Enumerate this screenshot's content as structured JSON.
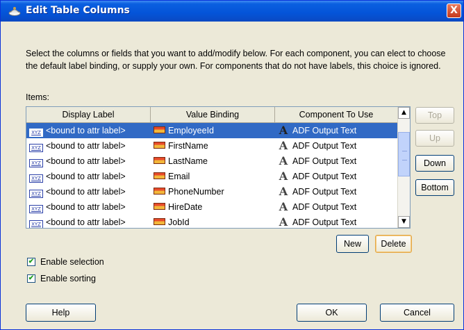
{
  "window": {
    "title": "Edit Table Columns",
    "close_label": "X"
  },
  "description": "Select the columns or fields that you want to add/modify below. For each component, you can elect to choose the default label binding, or supply your own. For components that do not have labels, this choice is ignored.",
  "items_label": "Items:",
  "table": {
    "headers": [
      "Display Label",
      "Value Binding",
      "Component To Use"
    ],
    "rows": [
      {
        "label": "<bound to attr label>",
        "binding": "EmployeeId",
        "component": "ADF Output Text",
        "selected": true
      },
      {
        "label": "<bound to attr label>",
        "binding": "FirstName",
        "component": "ADF Output Text"
      },
      {
        "label": "<bound to attr label>",
        "binding": "LastName",
        "component": "ADF Output Text"
      },
      {
        "label": "<bound to attr label>",
        "binding": "Email",
        "component": "ADF Output Text"
      },
      {
        "label": "<bound to attr label>",
        "binding": "PhoneNumber",
        "component": "ADF Output Text"
      },
      {
        "label": "<bound to attr label>",
        "binding": "HireDate",
        "component": "ADF Output Text"
      },
      {
        "label": "<bound to attr label>",
        "binding": "JobId",
        "component": "ADF Output Text"
      }
    ],
    "label_icon": "xyz-icon",
    "binding_icon": "attribute-binding-icon",
    "component_icon": "adf-component-icon",
    "selection_color": "#316ac5"
  },
  "side_buttons": {
    "top": "Top",
    "up": "Up",
    "down": "Down",
    "bottom": "Bottom"
  },
  "table_buttons": {
    "new": "New",
    "delete": "Delete"
  },
  "checkboxes": {
    "selection": {
      "label": "Enable selection",
      "checked": true
    },
    "sorting": {
      "label": "Enable sorting",
      "checked": true
    }
  },
  "footer": {
    "help": "Help",
    "ok": "OK",
    "cancel": "Cancel"
  },
  "accent_color": "#0a5fe0"
}
